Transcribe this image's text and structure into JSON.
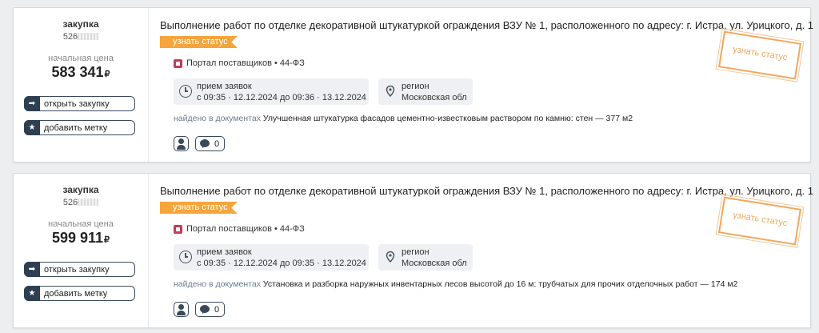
{
  "cards": [
    {
      "kind": "закупка",
      "number_prefix": "526",
      "price_label": "начальная цена",
      "price": "583 341",
      "currency": "₽",
      "open_label": "открыть закупку",
      "mark_label": "добавить метку",
      "title": "Выполнение работ по отделке декоративной штукатуркой ограждения ВЗУ № 1, расположенного по адресу: г. Истра, ул. Урицкого, д. 1",
      "status_ribbon": "узнать статус",
      "portal": "Портал поставщиков • 44-ФЗ",
      "period_label": "прием заявок",
      "period_value": "с 09:35 · 12.12.2024 до 09:36 · 13.12.2024",
      "region_label": "регион",
      "region_value": "Московская обл",
      "found_label": "найдено в документах",
      "found_text": "Улучшенная штукатурка фасадов цементно-известковым раствором по камню: стен — 377 м2",
      "comments": "0",
      "stamp": "узнать статус"
    },
    {
      "kind": "закупка",
      "number_prefix": "526",
      "price_label": "начальная цена",
      "price": "599 911",
      "currency": "₽",
      "open_label": "открыть закупку",
      "mark_label": "добавить метку",
      "title": "Выполнение работ по отделке декоративной штукатуркой ограждения ВЗУ № 1, расположенного по адресу: г. Истра, ул. Урицкого, д. 1",
      "status_ribbon": "узнать статус",
      "portal": "Портал поставщиков • 44-ФЗ",
      "period_label": "прием заявок",
      "period_value": "с 09:35 · 12.12.2024 до 09:35 · 13.12.2024",
      "region_label": "регион",
      "region_value": "Московская обл",
      "found_label": "найдено в документах",
      "found_text": "Установка и разборка наружных инвентарных лесов высотой до 16 м: трубчатых для прочих отделочных работ — 174 м2",
      "comments": "0",
      "stamp": "узнать статус"
    }
  ]
}
